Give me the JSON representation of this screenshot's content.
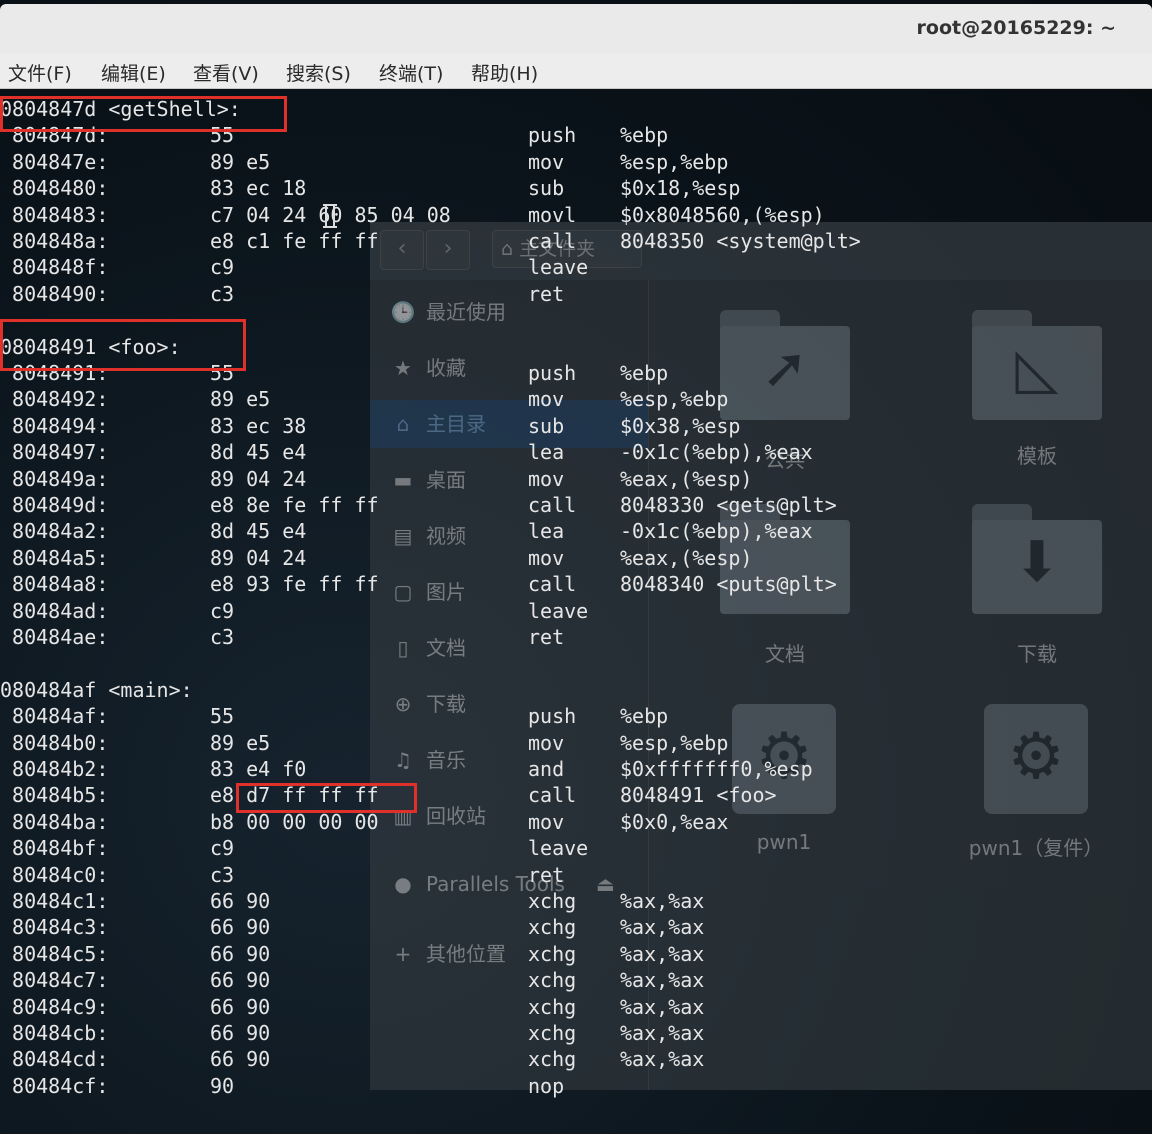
{
  "window": {
    "title": "root@20165229: ~"
  },
  "menu": {
    "items": [
      "文件(F)",
      "编辑(E)",
      "查看(V)",
      "搜索(S)",
      "终端(T)",
      "帮助(H)"
    ]
  },
  "file_manager": {
    "path_label": "主文件夹",
    "nav_back": "‹",
    "nav_forward": "›",
    "sidebar": [
      {
        "icon": "clock-icon",
        "glyph": "🕒",
        "label": "最近使用"
      },
      {
        "icon": "star-icon",
        "glyph": "★",
        "label": "收藏"
      },
      {
        "icon": "home-icon",
        "glyph": "⌂",
        "label": "主目录"
      },
      {
        "icon": "desktop-icon",
        "glyph": "▬",
        "label": "桌面"
      },
      {
        "icon": "video-icon",
        "glyph": "▤",
        "label": "视频"
      },
      {
        "icon": "picture-icon",
        "glyph": "▢",
        "label": "图片"
      },
      {
        "icon": "document-icon",
        "glyph": "▯",
        "label": "文档"
      },
      {
        "icon": "download-icon",
        "glyph": "⊕",
        "label": "下载"
      },
      {
        "icon": "music-icon",
        "glyph": "♫",
        "label": "音乐"
      },
      {
        "icon": "trash-icon",
        "glyph": "▥",
        "label": "回收站"
      },
      {
        "icon": "disc-icon",
        "glyph": "●",
        "label": "Parallels Tools",
        "eject": "⏏"
      },
      {
        "icon": "plus-icon",
        "glyph": "+",
        "label": "其他位置"
      }
    ],
    "items": [
      {
        "icon": "share-folder-icon",
        "label": "公共"
      },
      {
        "icon": "template-folder-icon",
        "label": "模板"
      },
      {
        "icon": "document-folder-icon",
        "label": "文档"
      },
      {
        "icon": "download-folder-icon",
        "label": "下载"
      },
      {
        "icon": "executable-icon",
        "label": "pwn1"
      },
      {
        "icon": "executable-icon",
        "label": "pwn1（复件）"
      }
    ]
  },
  "terminal": {
    "blocks": [
      {
        "label": "0804847d <getShell>:",
        "lines": [
          {
            "addr": " 804847d:",
            "bytes": "55",
            "mnem": "push",
            "ops": "%ebp"
          },
          {
            "addr": " 804847e:",
            "bytes": "89 e5",
            "mnem": "mov",
            "ops": "%esp,%ebp"
          },
          {
            "addr": " 8048480:",
            "bytes": "83 ec 18",
            "mnem": "sub",
            "ops": "$0x18,%esp"
          },
          {
            "addr": " 8048483:",
            "bytes": "c7 04 24 60 85 04 08",
            "mnem": "movl",
            "ops": "$0x8048560,(%esp)"
          },
          {
            "addr": " 804848a:",
            "bytes": "e8 c1 fe ff ff",
            "mnem": "call",
            "ops": "8048350 <system@plt>"
          },
          {
            "addr": " 804848f:",
            "bytes": "c9",
            "mnem": "leave",
            "ops": ""
          },
          {
            "addr": " 8048490:",
            "bytes": "c3",
            "mnem": "ret",
            "ops": ""
          }
        ]
      },
      {
        "label": "08048491 <foo>:",
        "lines": [
          {
            "addr": " 8048491:",
            "bytes": "55",
            "mnem": "push",
            "ops": "%ebp"
          },
          {
            "addr": " 8048492:",
            "bytes": "89 e5",
            "mnem": "mov",
            "ops": "%esp,%ebp"
          },
          {
            "addr": " 8048494:",
            "bytes": "83 ec 38",
            "mnem": "sub",
            "ops": "$0x38,%esp"
          },
          {
            "addr": " 8048497:",
            "bytes": "8d 45 e4",
            "mnem": "lea",
            "ops": "-0x1c(%ebp),%eax"
          },
          {
            "addr": " 804849a:",
            "bytes": "89 04 24",
            "mnem": "mov",
            "ops": "%eax,(%esp)"
          },
          {
            "addr": " 804849d:",
            "bytes": "e8 8e fe ff ff",
            "mnem": "call",
            "ops": "8048330 <gets@plt>"
          },
          {
            "addr": " 80484a2:",
            "bytes": "8d 45 e4",
            "mnem": "lea",
            "ops": "-0x1c(%ebp),%eax"
          },
          {
            "addr": " 80484a5:",
            "bytes": "89 04 24",
            "mnem": "mov",
            "ops": "%eax,(%esp)"
          },
          {
            "addr": " 80484a8:",
            "bytes": "e8 93 fe ff ff",
            "mnem": "call",
            "ops": "8048340 <puts@plt>"
          },
          {
            "addr": " 80484ad:",
            "bytes": "c9",
            "mnem": "leave",
            "ops": ""
          },
          {
            "addr": " 80484ae:",
            "bytes": "c3",
            "mnem": "ret",
            "ops": ""
          }
        ]
      },
      {
        "label": "080484af <main>:",
        "lines": [
          {
            "addr": " 80484af:",
            "bytes": "55",
            "mnem": "push",
            "ops": "%ebp"
          },
          {
            "addr": " 80484b0:",
            "bytes": "89 e5",
            "mnem": "mov",
            "ops": "%esp,%ebp"
          },
          {
            "addr": " 80484b2:",
            "bytes": "83 e4 f0",
            "mnem": "and",
            "ops": "$0xfffffff0,%esp"
          },
          {
            "addr": " 80484b5:",
            "bytes": "e8 d7 ff ff ff",
            "mnem": "call",
            "ops": "8048491 <foo>"
          },
          {
            "addr": " 80484ba:",
            "bytes": "b8 00 00 00 00",
            "mnem": "mov",
            "ops": "$0x0,%eax"
          },
          {
            "addr": " 80484bf:",
            "bytes": "c9",
            "mnem": "leave",
            "ops": ""
          },
          {
            "addr": " 80484c0:",
            "bytes": "c3",
            "mnem": "ret",
            "ops": ""
          },
          {
            "addr": " 80484c1:",
            "bytes": "66 90",
            "mnem": "xchg",
            "ops": "%ax,%ax"
          },
          {
            "addr": " 80484c3:",
            "bytes": "66 90",
            "mnem": "xchg",
            "ops": "%ax,%ax"
          },
          {
            "addr": " 80484c5:",
            "bytes": "66 90",
            "mnem": "xchg",
            "ops": "%ax,%ax"
          },
          {
            "addr": " 80484c7:",
            "bytes": "66 90",
            "mnem": "xchg",
            "ops": "%ax,%ax"
          },
          {
            "addr": " 80484c9:",
            "bytes": "66 90",
            "mnem": "xchg",
            "ops": "%ax,%ax"
          },
          {
            "addr": " 80484cb:",
            "bytes": "66 90",
            "mnem": "xchg",
            "ops": "%ax,%ax"
          },
          {
            "addr": " 80484cd:",
            "bytes": "66 90",
            "mnem": "xchg",
            "ops": "%ax,%ax"
          },
          {
            "addr": " 80484cf:",
            "bytes": "90",
            "mnem": "nop",
            "ops": ""
          }
        ]
      }
    ]
  },
  "colors": {
    "highlight": "#e0302a",
    "terminal_text": "#e6e6e6"
  }
}
